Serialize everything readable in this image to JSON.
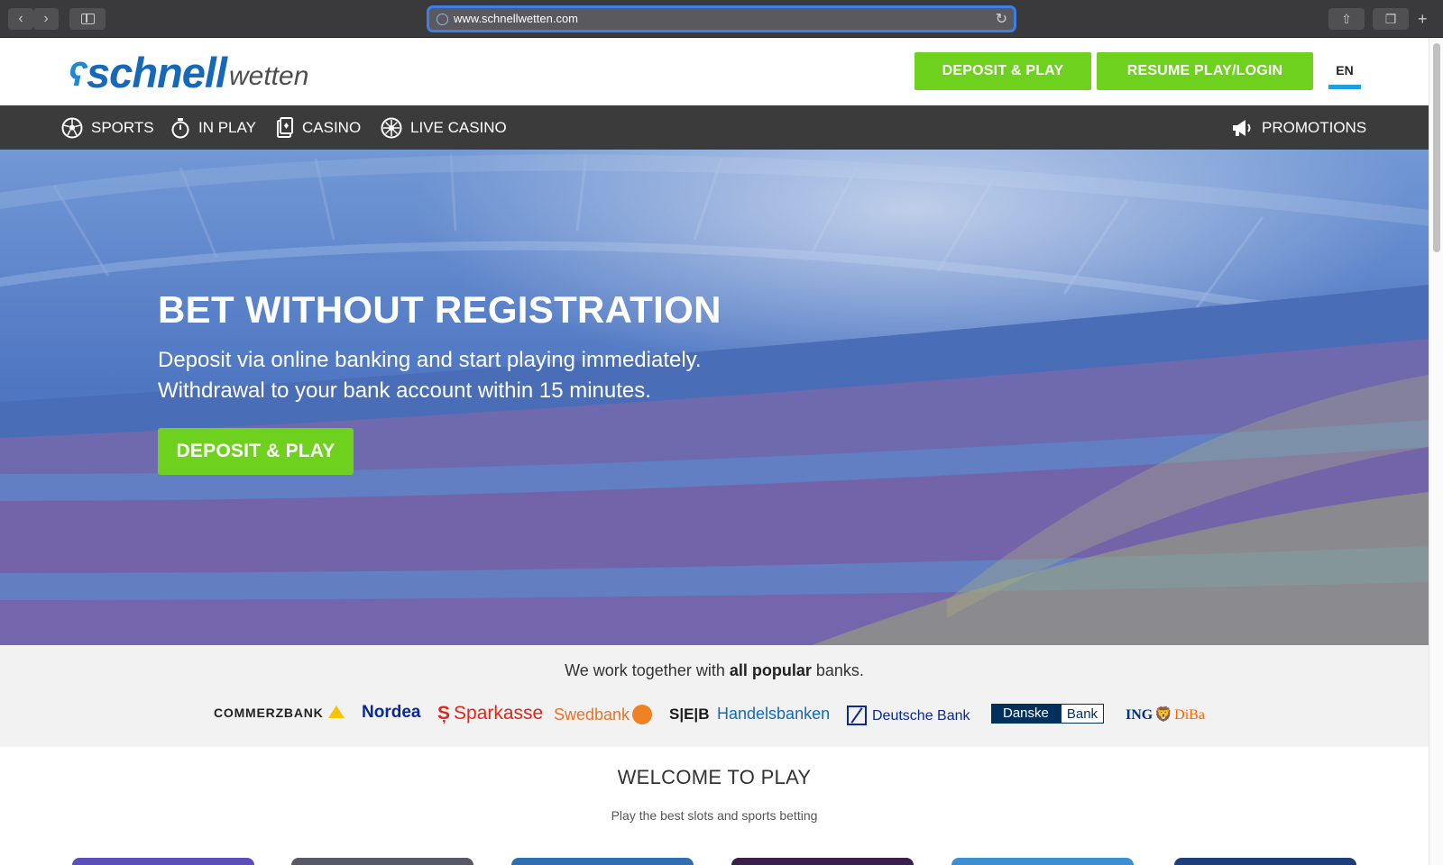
{
  "browser": {
    "url": "www.schnellwetten.com",
    "back_icon": "‹",
    "forward_icon": "›",
    "reload_icon": "↻",
    "share_icon": "⇧",
    "tabs_icon": "❐",
    "new_tab_icon": "+"
  },
  "header": {
    "logo": {
      "swoosh": "ʕ",
      "brand": "schnell",
      "brand_light": "wetten"
    },
    "deposit_label": "DEPOSIT & PLAY",
    "resume_label": "RESUME PLAY/LOGIN",
    "language": "EN"
  },
  "nav": {
    "items": [
      {
        "label": "SPORTS",
        "icon": "soccer-ball-icon"
      },
      {
        "label": "IN PLAY",
        "icon": "stopwatch-icon"
      },
      {
        "label": "CASINO",
        "icon": "card-icon"
      },
      {
        "label": "LIVE CASINO",
        "icon": "roulette-icon"
      },
      {
        "label": "PROMOTIONS",
        "icon": "megaphone-icon"
      }
    ]
  },
  "hero": {
    "title": "BET WITHOUT REGISTRATION",
    "line1": "Deposit via online banking and start playing immediately.",
    "line2": "Withdrawal to your bank account within 15 minutes.",
    "cta_label": "DEPOSIT & PLAY"
  },
  "banks": {
    "text_prefix": "We work together with ",
    "text_bold": "all popular",
    "text_suffix": " banks.",
    "logos": {
      "commerzbank": "COMMERZBANK",
      "nordea": "Nordea",
      "sparkasse_symbol": "Ș",
      "sparkasse": "Sparkasse",
      "swedbank": "Swedbank",
      "seb": "S|E|B",
      "handelsbanken": "Handelsbanken",
      "deutsche": "Deutsche Bank",
      "danske_1": "Danske",
      "danske_2": "Bank",
      "ing_1": "ING",
      "ing_lion": "🦁",
      "ing_2": "DiBa"
    }
  },
  "welcome": {
    "title": "WELCOME TO PLAY",
    "subtitle": "Play the best slots and sports betting"
  },
  "colors": {
    "accent_green": "#6dd11e",
    "nav_bg": "#3b3b3c",
    "brand_blue": "#1668b8",
    "language_underline": "#1ea0e6"
  }
}
